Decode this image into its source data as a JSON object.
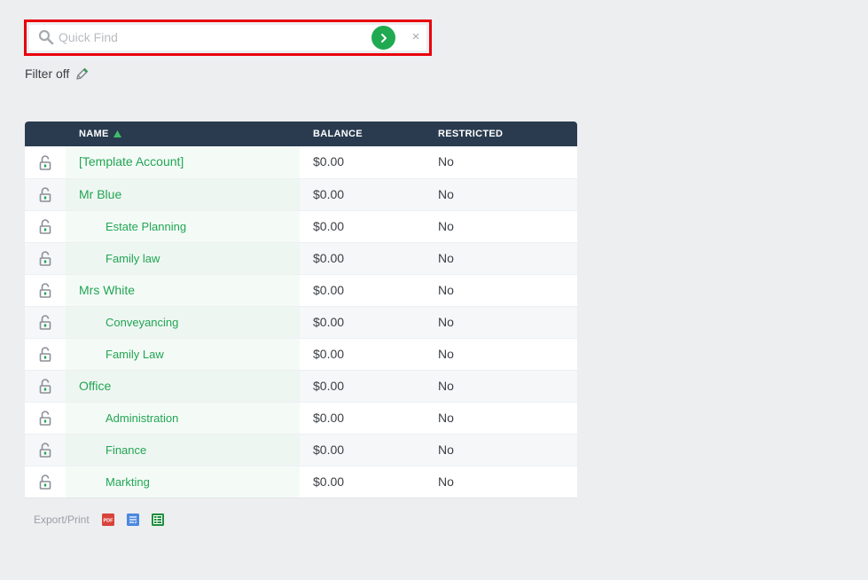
{
  "search": {
    "placeholder": "Quick Find",
    "value": "",
    "clear_label": "×"
  },
  "filter": {
    "label": "Filter off"
  },
  "table": {
    "columns": {
      "name": "NAME",
      "balance": "BALANCE",
      "restricted": "RESTRICTED"
    },
    "sort": {
      "column": "NAME",
      "direction": "ascending"
    },
    "rows": [
      {
        "name": "[Template Account]",
        "level": 0,
        "balance": "$0.00",
        "restricted": "No"
      },
      {
        "name": "Mr Blue",
        "level": 0,
        "balance": "$0.00",
        "restricted": "No"
      },
      {
        "name": "Estate Planning",
        "level": 1,
        "balance": "$0.00",
        "restricted": "No"
      },
      {
        "name": "Family law",
        "level": 1,
        "balance": "$0.00",
        "restricted": "No"
      },
      {
        "name": "Mrs White",
        "level": 0,
        "balance": "$0.00",
        "restricted": "No"
      },
      {
        "name": "Conveyancing",
        "level": 1,
        "balance": "$0.00",
        "restricted": "No"
      },
      {
        "name": "Family Law",
        "level": 1,
        "balance": "$0.00",
        "restricted": "No"
      },
      {
        "name": "Office",
        "level": 0,
        "balance": "$0.00",
        "restricted": "No"
      },
      {
        "name": "Administration",
        "level": 1,
        "balance": "$0.00",
        "restricted": "No"
      },
      {
        "name": "Finance",
        "level": 1,
        "balance": "$0.00",
        "restricted": "No"
      },
      {
        "name": "Markting",
        "level": 1,
        "balance": "$0.00",
        "restricted": "No"
      }
    ]
  },
  "export": {
    "label": "Export/Print",
    "pdf_text": "PDF",
    "buttons": [
      "pdf-icon",
      "csv-icon",
      "spreadsheet-icon"
    ]
  },
  "colors": {
    "accent": "#1faa52",
    "link": "#22a553",
    "header_bg": "#2a3b4f",
    "highlight": "#e8000b",
    "background": "#edeef0",
    "pdf": "#d9433a",
    "csv": "#4a88e0",
    "sheet": "#1e8e3e"
  }
}
